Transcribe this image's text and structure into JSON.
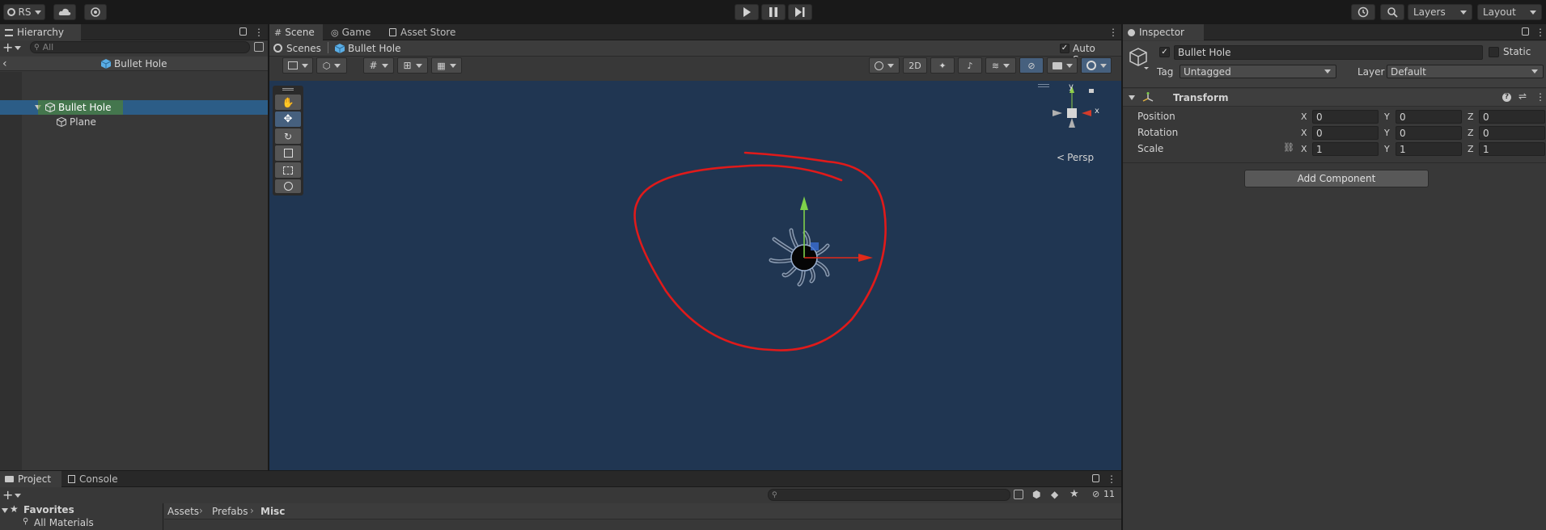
{
  "toolbar": {
    "account_label": "RS",
    "layers_label": "Layers",
    "layout_label": "Layout"
  },
  "hierarchy": {
    "tab_label": "Hierarchy",
    "search_placeholder": "All",
    "prefab_title": "Bullet Hole",
    "items": [
      {
        "label": "Bullet Hole"
      },
      {
        "label": "Plane"
      }
    ]
  },
  "scene": {
    "tabs": [
      {
        "label": "Scene"
      },
      {
        "label": "Game"
      },
      {
        "label": "Asset Store"
      }
    ],
    "breadcrumb_root": "Scenes",
    "breadcrumb_current": "Bullet Hole",
    "auto_save_label": "Auto Save",
    "mode_2d_label": "2D",
    "gizmo": {
      "x_label": "x",
      "y_label": "y",
      "projection_label": "Persp"
    },
    "annotation_color": "#e01a1a",
    "background_color": "#203652"
  },
  "inspector": {
    "tab_label": "Inspector",
    "object_name": "Bullet Hole",
    "static_label": "Static",
    "tag_label": "Tag",
    "tag_value": "Untagged",
    "layer_label": "Layer",
    "layer_value": "Default",
    "component_title": "Transform",
    "properties": [
      {
        "label": "Position",
        "x": "0",
        "y": "0",
        "z": "0"
      },
      {
        "label": "Rotation",
        "x": "0",
        "y": "0",
        "z": "0"
      },
      {
        "label": "Scale",
        "x": "1",
        "y": "1",
        "z": "1"
      }
    ],
    "axis_labels": {
      "x": "X",
      "y": "Y",
      "z": "Z"
    },
    "add_component_label": "Add Component"
  },
  "project": {
    "tabs": [
      {
        "label": "Project"
      },
      {
        "label": "Console"
      }
    ],
    "favorites_label": "Favorites",
    "favorites_items": [
      {
        "label": "All Materials"
      }
    ],
    "breadcrumb": [
      {
        "label": "Assets"
      },
      {
        "label": "Prefabs"
      },
      {
        "label": "Misc"
      }
    ],
    "hidden_count": "11"
  }
}
